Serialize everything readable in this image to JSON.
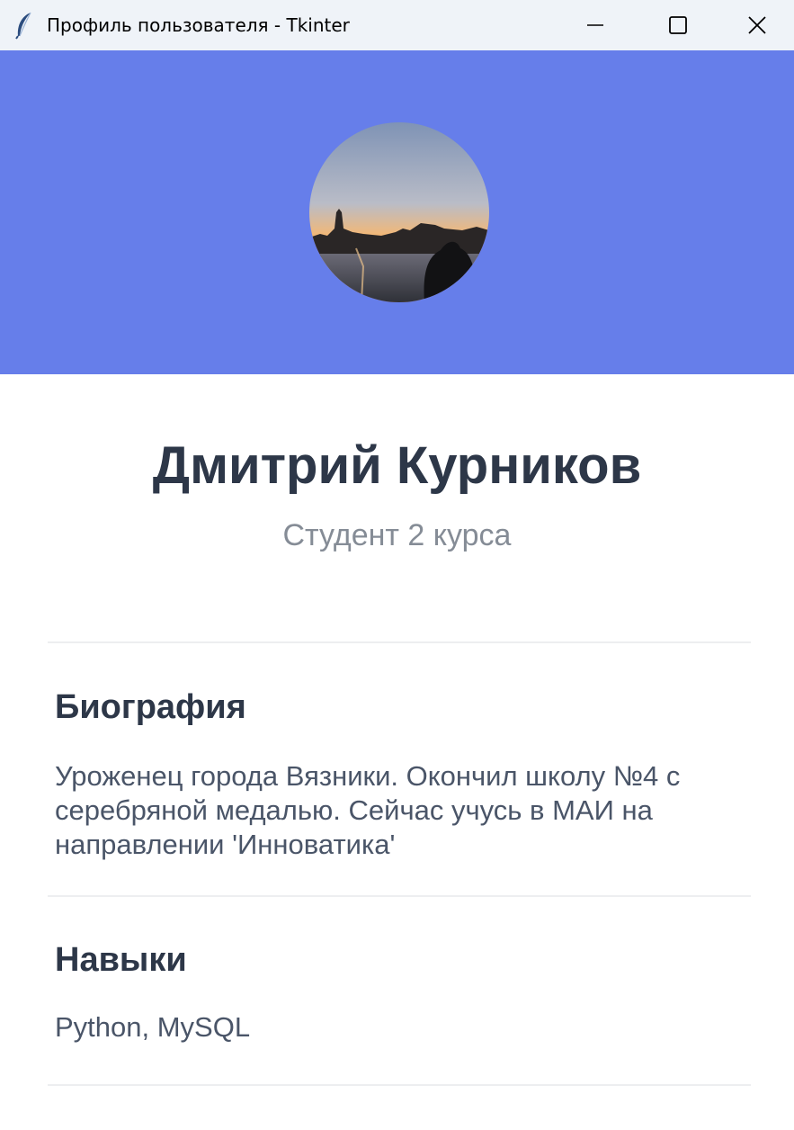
{
  "window": {
    "title": "Профиль пользователя - Tkinter",
    "icon": "feather-icon",
    "controls": [
      "minimize-icon",
      "maximize-icon",
      "close-icon"
    ]
  },
  "colors": {
    "banner": "#667eea",
    "name": "#2d3748",
    "subtitle": "#858c96",
    "body_text": "#4a5568",
    "divider": "#edeef0"
  },
  "profile": {
    "avatar": "avatar-photo (city skyline at sunset by a river)",
    "name": "Дмитрий Курников",
    "subtitle": "Студент 2 курса"
  },
  "sections": [
    {
      "title": "Биография",
      "lines": [
        "Уроженец города Вязники. Окончил школу №4 с",
        "серебряной медалью. Сейчас учусь в МАИ на",
        "направлении 'Инноватика'"
      ]
    },
    {
      "title": "Навыки",
      "lines": [
        "Python, MySQL"
      ]
    }
  ]
}
